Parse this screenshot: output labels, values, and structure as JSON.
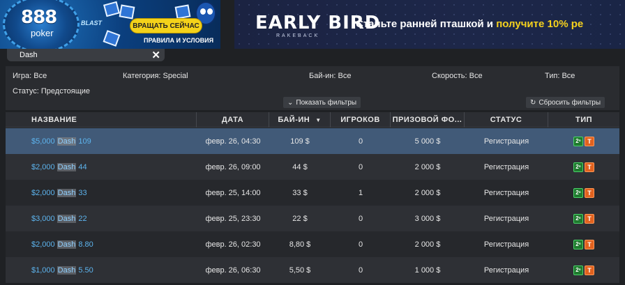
{
  "banner_left": {
    "logo": "888",
    "logo_sub": "poker",
    "blast": "BLAST",
    "cta": "ВРАЩАТЬ СЕЙЧАС",
    "terms": "ПРАВИЛА И УСЛОВИЯ"
  },
  "banner_right": {
    "title": "EARLY BIRD",
    "subtitle": "RAKEBACK",
    "promo_text": "Станьте ранней пташкой и ",
    "promo_highlight": "получите 10% ре"
  },
  "search": {
    "value": "Dash",
    "close_icon": "✕"
  },
  "filters": {
    "game": "Игра: Все",
    "category": "Категория: Special",
    "buyin": "Бай-ин: Все",
    "speed": "Скорость: Все",
    "type": "Тип: Все",
    "status": "Статус: Предстоящие",
    "show_filters": "Показать фильтры",
    "reset_filters": "Сбросить фильтры"
  },
  "table": {
    "headers": {
      "name": "НАЗВАНИЕ",
      "date": "ДАТА",
      "buyin": "БАЙ-ИН",
      "players": "ИГРОКОВ",
      "prize": "ПРИЗОВОЙ ФО...",
      "status": "СТАТУС",
      "type": "ТИП"
    },
    "sort_column": "buyin",
    "rows": [
      {
        "prefix": "$5,000",
        "highlight": "Dash",
        "suffix": "109",
        "date": "февр. 26, 04:30",
        "buyin": "109 $",
        "players": "0",
        "prize": "5 000 $",
        "status": "Регистрация",
        "badge1": "2ⁿ",
        "badge2": "T",
        "selected": true
      },
      {
        "prefix": "$2,000",
        "highlight": "Dash",
        "suffix": "44",
        "date": "февр. 26, 09:00",
        "buyin": "44 $",
        "players": "0",
        "prize": "2 000 $",
        "status": "Регистрация",
        "badge1": "2ⁿ",
        "badge2": "T"
      },
      {
        "prefix": "$2,000",
        "highlight": "Dash",
        "suffix": "33",
        "date": "февр. 25, 14:00",
        "buyin": "33 $",
        "players": "1",
        "prize": "2 000 $",
        "status": "Регистрация",
        "badge1": "2ⁿ",
        "badge2": "T"
      },
      {
        "prefix": "$3,000",
        "highlight": "Dash",
        "suffix": "22",
        "date": "февр. 25, 23:30",
        "buyin": "22 $",
        "players": "0",
        "prize": "3 000 $",
        "status": "Регистрация",
        "badge1": "2ⁿ",
        "badge2": "T"
      },
      {
        "prefix": "$2,000",
        "highlight": "Dash",
        "suffix": "8.80",
        "date": "февр. 26, 02:30",
        "buyin": "8,80 $",
        "players": "0",
        "prize": "2 000 $",
        "status": "Регистрация",
        "badge1": "2ⁿ",
        "badge2": "T"
      },
      {
        "prefix": "$1,000",
        "highlight": "Dash",
        "suffix": "5.50",
        "date": "февр. 26, 06:30",
        "buyin": "5,50 $",
        "players": "0",
        "prize": "1 000 $",
        "status": "Регистрация",
        "badge1": "2ⁿ",
        "badge2": "T"
      }
    ]
  },
  "colors": {
    "accent_link": "#5db4ee",
    "selected_row": "#415a78",
    "cta_yellow": "#f4d21a"
  }
}
